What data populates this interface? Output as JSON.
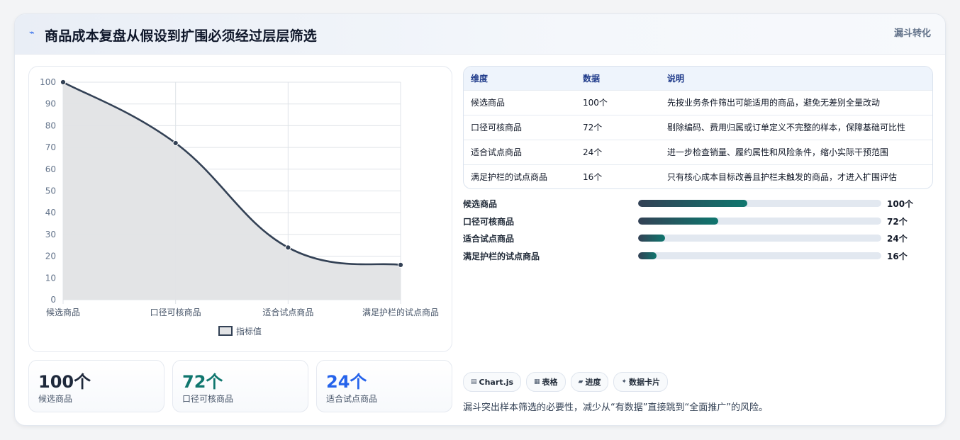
{
  "header": {
    "icon": "trend-line-icon",
    "title": "商品成本复盘从假设到扩围必须经过层层筛选",
    "tag": "漏斗转化"
  },
  "chart_data": {
    "type": "area",
    "categories": [
      "候选商品",
      "口径可核商品",
      "适合试点商品",
      "满足护栏的试点商品"
    ],
    "series": [
      {
        "name": "指标值",
        "values": [
          100,
          72,
          24,
          16
        ]
      }
    ],
    "ylim": [
      0,
      100
    ],
    "yticks": [
      0,
      10,
      20,
      30,
      40,
      50,
      60,
      70,
      80,
      90,
      100
    ],
    "grid": true,
    "legend_position": "bottom",
    "line_color": "#334155",
    "fill_color": "#e2e3e5"
  },
  "kpis": [
    {
      "value": "100个",
      "label": "候选商品",
      "color": "#1e293b"
    },
    {
      "value": "72个",
      "label": "口径可核商品",
      "color": "#0f766e"
    },
    {
      "value": "24个",
      "label": "适合试点商品",
      "color": "#2563eb"
    }
  ],
  "table": {
    "headers": [
      "维度",
      "数据",
      "说明"
    ],
    "rows": [
      [
        "候选商品",
        "100个",
        "先按业务条件筛出可能适用的商品，避免无差别全量改动"
      ],
      [
        "口径可核商品",
        "72个",
        "剔除编码、费用归属或订单定义不完整的样本，保障基础可比性"
      ],
      [
        "适合试点商品",
        "24个",
        "进一步检查销量、履约属性和风险条件，缩小实际干预范围"
      ],
      [
        "满足护栏的试点商品",
        "16个",
        "只有核心成本目标改善且护栏未触发的商品，才进入扩围评估"
      ]
    ]
  },
  "progress": [
    {
      "label": "候选商品",
      "value": "100个",
      "fraction": 0.45
    },
    {
      "label": "口径可核商品",
      "value": "72个",
      "fraction": 0.33
    },
    {
      "label": "适合试点商品",
      "value": "24个",
      "fraction": 0.11
    },
    {
      "label": "满足护栏的试点商品",
      "value": "16个",
      "fraction": 0.075
    }
  ],
  "chips": [
    {
      "icon": "chart-icon",
      "glyph": "▤",
      "label": "Chart.js"
    },
    {
      "icon": "table-icon",
      "glyph": "▦",
      "label": "表格"
    },
    {
      "icon": "progress-icon",
      "glyph": "▰",
      "label": "进度"
    },
    {
      "icon": "sparkle-icon",
      "glyph": "✦",
      "label": "数据卡片"
    }
  ],
  "footer": {
    "note": "漏斗突出样本筛选的必要性，减少从“有数据”直接跳到“全面推广”的风险。"
  }
}
